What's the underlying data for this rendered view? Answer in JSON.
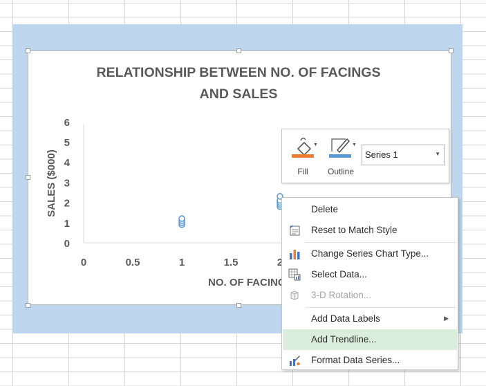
{
  "chart": {
    "title_line1": "RELATIONSHIP BETWEEN NO. OF FACINGS",
    "title_line2": "AND SALES"
  },
  "chart_data": {
    "type": "scatter",
    "title": "RELATIONSHIP BETWEEN NO. OF FACINGS AND SALES",
    "xlabel": "NO. OF FACINGS",
    "ylabel": "SALES ($000)",
    "xlim": [
      0,
      2.5
    ],
    "ylim": [
      0,
      6
    ],
    "x_ticks": [
      "0",
      "0.5",
      "1",
      "1.5",
      "2"
    ],
    "y_ticks": [
      "0",
      "1",
      "2",
      "3",
      "4",
      "5",
      "6"
    ],
    "series": [
      {
        "x": [
          1,
          1,
          1,
          1,
          2,
          2,
          2,
          2,
          2
        ],
        "y": [
          0.9,
          1.0,
          1.1,
          1.2,
          1.8,
          1.9,
          2.0,
          2.1,
          2.3
        ]
      }
    ],
    "grid": false,
    "legend": "none"
  },
  "toolbar": {
    "fill_label": "Fill",
    "outline_label": "Outline",
    "series_selected": "Series 1",
    "fill_color": "#ed7d31",
    "outline_color": "#5b9bd5"
  },
  "context_menu": {
    "items": [
      {
        "label": "Delete",
        "icon": "none",
        "disabled": false
      },
      {
        "label": "Reset to Match Style",
        "icon": "reset-style-icon",
        "disabled": false
      },
      {
        "label": "Change Series Chart Type...",
        "icon": "bar-chart-icon",
        "disabled": false
      },
      {
        "label": "Select Data...",
        "icon": "select-data-icon",
        "disabled": false
      },
      {
        "label": "3-D Rotation...",
        "icon": "cube-icon",
        "disabled": true
      },
      {
        "label": "Add Data Labels",
        "icon": "none",
        "disabled": false
      },
      {
        "label": "Add Trendline...",
        "icon": "none",
        "disabled": false
      },
      {
        "label": "Format Data Series...",
        "icon": "format-series-icon",
        "disabled": false
      }
    ]
  }
}
